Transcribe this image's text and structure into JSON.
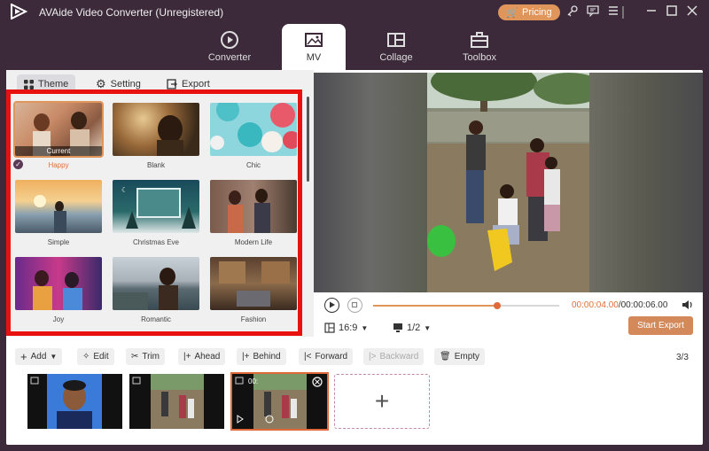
{
  "app": {
    "title": "AVAide Video Converter (Unregistered)",
    "pricing_label": "Pricing",
    "accent_color": "#e0955a"
  },
  "window_icons": [
    "key-icon",
    "feedback-icon",
    "menu-icon",
    "minimize-icon",
    "maximize-icon",
    "close-icon"
  ],
  "tabs": [
    {
      "label": "Converter",
      "icon": "converter-icon"
    },
    {
      "label": "MV",
      "icon": "mv-icon",
      "active": true
    },
    {
      "label": "Collage",
      "icon": "collage-icon"
    },
    {
      "label": "Toolbox",
      "icon": "toolbox-icon"
    }
  ],
  "subtabs": [
    {
      "label": "Theme",
      "icon": "grid-icon",
      "active": true
    },
    {
      "label": "Setting",
      "icon": "gear-icon"
    },
    {
      "label": "Export",
      "icon": "export-icon"
    }
  ],
  "themes": [
    {
      "name": "Happy",
      "badge": "Current",
      "selected": true
    },
    {
      "name": "Blank"
    },
    {
      "name": "Chic"
    },
    {
      "name": "Simple"
    },
    {
      "name": "Christmas Eve"
    },
    {
      "name": "Modern Life"
    },
    {
      "name": "Joy"
    },
    {
      "name": "Romantic"
    },
    {
      "name": "Fashion"
    }
  ],
  "player": {
    "current_time": "00:00:04.00",
    "total_time": "/00:00:06.00",
    "progress": 0.667,
    "aspect_ratio": "16:9",
    "page": "1/2",
    "export_label": "Start Export"
  },
  "toolbar": {
    "add": "Add",
    "edit": "Edit",
    "trim": "Trim",
    "ahead": "Ahead",
    "behind": "Behind",
    "forward": "Forward",
    "backward": "Backward",
    "empty": "Empty",
    "count": "3/3"
  },
  "clips": {
    "third_clip_time": "00:"
  }
}
